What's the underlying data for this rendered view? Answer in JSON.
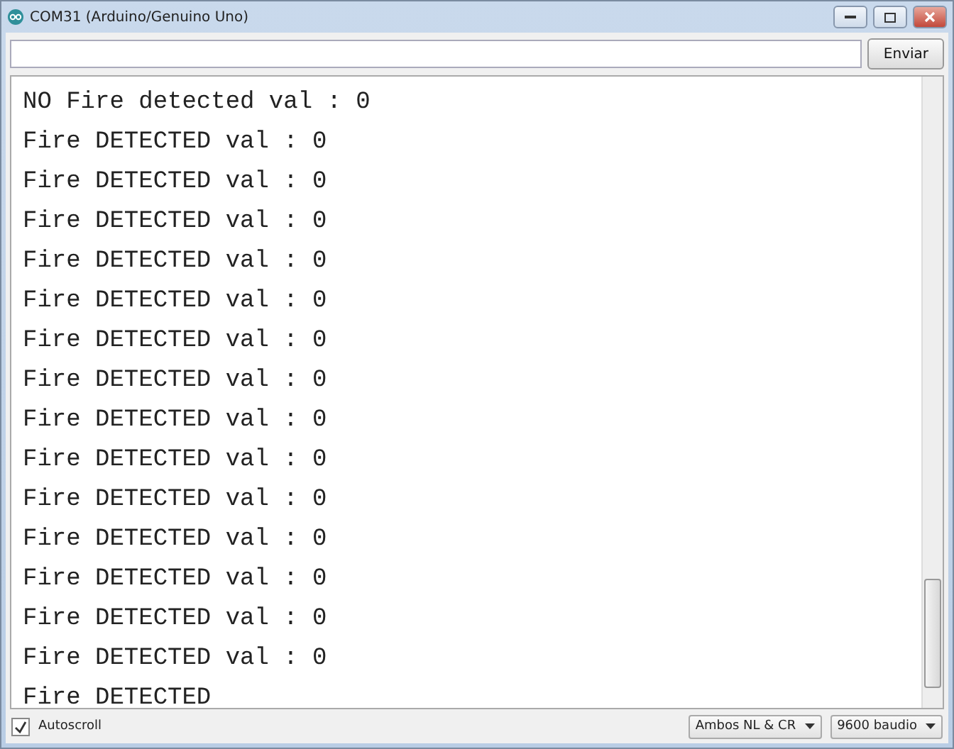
{
  "window": {
    "title": "COM31 (Arduino/Genuino Uno)"
  },
  "send": {
    "button": "Enviar"
  },
  "output": {
    "lines": [
      "NO Fire detected val : 0",
      "Fire DETECTED val : 0",
      "Fire DETECTED val : 0",
      "Fire DETECTED val : 0",
      "Fire DETECTED val : 0",
      "Fire DETECTED val : 0",
      "Fire DETECTED val : 0",
      "Fire DETECTED val : 0",
      "Fire DETECTED val : 0",
      "Fire DETECTED val : 0",
      "Fire DETECTED val : 0",
      "Fire DETECTED val : 0",
      "Fire DETECTED val : 0",
      "Fire DETECTED val : 0",
      "Fire DETECTED val : 0",
      "Fire DETECTED"
    ]
  },
  "status_bar": {
    "autoscroll": {
      "label": "Autoscroll",
      "checked": true
    },
    "line_ending": "Ambos NL & CR",
    "baud": "9600 baudio"
  }
}
